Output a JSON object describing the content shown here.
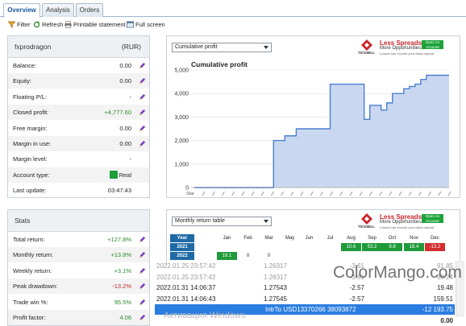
{
  "tabs": [
    {
      "label": "Overview",
      "active": true
    },
    {
      "label": "Analysis",
      "active": false
    },
    {
      "label": "Orders",
      "active": false
    }
  ],
  "toolbar": {
    "filter": "Filter",
    "refresh": "Refresh",
    "print": "Printable statement",
    "fullscreen": "Full screen"
  },
  "account": {
    "name": "fxprodragon",
    "currency": "(RUR)",
    "rows": [
      {
        "label": "Balance:",
        "value": "0.00",
        "tone": "",
        "icon": true
      },
      {
        "label": "Equity:",
        "value": "0.00",
        "tone": "",
        "icon": true
      },
      {
        "label": "Floating P/L:",
        "value": "-",
        "tone": "",
        "icon": true
      },
      {
        "label": "Closed profit:",
        "value": "+4,777.60",
        "tone": "green",
        "icon": true
      },
      {
        "label": "Free margin:",
        "value": "0.00",
        "tone": "",
        "icon": true
      },
      {
        "label": "Margin in use:",
        "value": "0.00",
        "tone": "",
        "icon": true
      },
      {
        "label": "Margin level:",
        "value": "-",
        "tone": "",
        "icon": false
      },
      {
        "label": "Account type:",
        "value": "Real",
        "tone": "",
        "icon": false
      },
      {
        "label": "Last update:",
        "value": "03:47:43",
        "tone": "",
        "icon": false
      }
    ]
  },
  "stats": {
    "title": "Stats",
    "rows": [
      {
        "label": "Total return:",
        "value": "+127.8%",
        "tone": "green"
      },
      {
        "label": "Monthly return:",
        "value": "+13.8%",
        "tone": "green"
      },
      {
        "label": "Weekly return:",
        "value": "+3.1%",
        "tone": "green"
      },
      {
        "label": "Peak drawdown:",
        "value": "-13.2%",
        "tone": "red"
      },
      {
        "label": "Trade win %:",
        "value": "95.5%",
        "tone": "green"
      },
      {
        "label": "Profit factor:",
        "value": "4.06",
        "tone": "green"
      }
    ]
  },
  "chart_panel": {
    "select": "Cumulative profit",
    "ad": {
      "headline": "Less Spreads.",
      "sub": "More Opportunities.",
      "button": "Open An Account",
      "fine": "Losses can exceed your initial deposit",
      "brand": "TICKMILL"
    }
  },
  "chart_data": {
    "type": "area",
    "title": "Cumulative profit",
    "ylim": [
      0,
      5000
    ],
    "yticks": [
      "5,000",
      "4,000",
      "3,000",
      "2,000",
      "1,000",
      "0"
    ],
    "x_first_label": "Star",
    "points": [
      0,
      0,
      0,
      0,
      0,
      0,
      0,
      0,
      0,
      0,
      0,
      0,
      0,
      0,
      2000,
      2000,
      2200,
      2200,
      2500,
      2500,
      2500,
      2500,
      2500,
      2500,
      4400,
      4400,
      4400,
      4400,
      4400,
      4400,
      2900,
      3500,
      3500,
      3300,
      3600,
      4000,
      4000,
      4200,
      4300,
      4400,
      4600,
      4777.6,
      4777.6,
      4777.6,
      4777.6,
      4777.6
    ],
    "grid": true,
    "color": "#4a7fd0"
  },
  "monthly_panel": {
    "select": "Monthly return table",
    "ad": {
      "headline": "Less Spreads.",
      "sub": "More Opportunities.",
      "button": "Open An Account",
      "fine": "Losses can exceed your initial deposit",
      "brand": "TICKMILL"
    },
    "header": [
      "Year",
      "Jan",
      "Feb",
      "Mar",
      "May",
      "Jun",
      "Jul",
      "Aug",
      "Sep",
      "Oct",
      "Nov",
      "Dec"
    ],
    "rows": [
      {
        "year": "2021",
        "cells": [
          "",
          "",
          "",
          "",
          "",
          "",
          "10.6",
          "53.2",
          "9.8",
          "18.4",
          "-13.2"
        ]
      },
      {
        "year": "2022",
        "cells": [
          "19.1",
          "0",
          "0",
          "",
          "",
          "",
          "",
          "",
          "",
          "",
          ""
        ]
      }
    ]
  },
  "history": [
    {
      "date": "2022.01.25 23:57:42",
      "price": "1.26317",
      "profit": "-3.61",
      "balance": "91.85",
      "style": "fade"
    },
    {
      "date": "2022.01.25 23:57:42",
      "price": "1.26317",
      "profit": "-3.61",
      "balance": "88.24",
      "style": "fade"
    },
    {
      "date": "2022.01.31 14:06:37",
      "price": "1.27543",
      "profit": "-2.57",
      "balance": "19.48",
      "style": ""
    },
    {
      "date": "2022.01.31 14:06:43",
      "price": "1.27545",
      "profit": "-2.57",
      "balance": "159.51",
      "style": ""
    },
    {
      "date": "",
      "price": "IntrTo USD13370266 38093872",
      "profit": "",
      "balance": "-12 193.75",
      "style": "blue"
    },
    {
      "date": "",
      "price": "",
      "profit": "",
      "balance": "0.00",
      "style": "tot"
    }
  ],
  "watermark": {
    "brand1": "Color",
    "brand2": "Mango",
    "tld": ".com"
  },
  "os_watermark": "Активация Windows"
}
